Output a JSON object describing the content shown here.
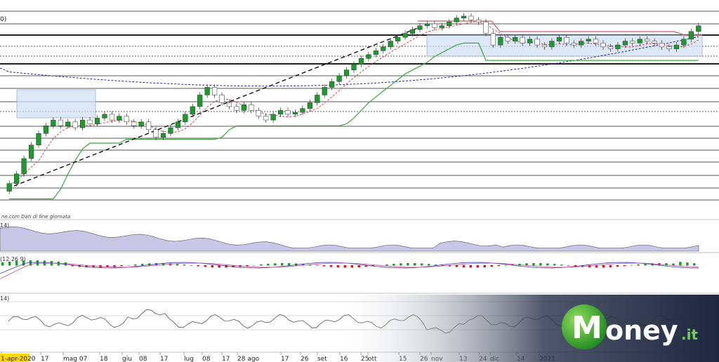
{
  "chart_data": {
    "type": "candlestick",
    "source_note": "ne.com  Dati di fine giornata",
    "x_tick_labels": [
      {
        "label": "1-apr-2020",
        "highlight": true
      },
      {
        "label": "17"
      },
      {
        "label": "mag 07"
      },
      {
        "label": "18"
      },
      {
        "label": "giu"
      },
      {
        "label": "08"
      },
      {
        "label": "17"
      },
      {
        "label": "lug"
      },
      {
        "label": "08"
      },
      {
        "label": "17"
      },
      {
        "label": "28 ago"
      },
      {
        "label": "17"
      },
      {
        "label": "26"
      },
      {
        "label": "set"
      },
      {
        "label": "16"
      },
      {
        "label": "25"
      },
      {
        "label": "ott"
      },
      {
        "label": "15"
      },
      {
        "label": "26"
      },
      {
        "label": "nov"
      },
      {
        "label": "13"
      },
      {
        "label": "24"
      },
      {
        "label": "dic"
      },
      {
        "label": "14"
      },
      {
        "label": "2021"
      }
    ],
    "price_series": [
      {
        "o": 10,
        "c": 14
      },
      {
        "o": 14,
        "c": 19
      },
      {
        "o": 19,
        "c": 27
      },
      {
        "o": 27,
        "c": 34
      },
      {
        "o": 34,
        "c": 40
      },
      {
        "o": 40,
        "c": 44
      },
      {
        "o": 44,
        "c": 47
      },
      {
        "o": 47,
        "c": 44
      },
      {
        "o": 44,
        "c": 46
      },
      {
        "o": 46,
        "c": 43
      },
      {
        "o": 43,
        "c": 47
      },
      {
        "o": 47,
        "c": 45
      },
      {
        "o": 45,
        "c": 48
      },
      {
        "o": 48,
        "c": 50
      },
      {
        "o": 50,
        "c": 47
      },
      {
        "o": 47,
        "c": 49
      },
      {
        "o": 49,
        "c": 46
      },
      {
        "o": 46,
        "c": 44
      },
      {
        "o": 44,
        "c": 46
      },
      {
        "o": 46,
        "c": 42
      },
      {
        "o": 42,
        "c": 38
      },
      {
        "o": 38,
        "c": 40
      },
      {
        "o": 40,
        "c": 43
      },
      {
        "o": 43,
        "c": 46
      },
      {
        "o": 46,
        "c": 50
      },
      {
        "o": 50,
        "c": 54
      },
      {
        "o": 54,
        "c": 60
      },
      {
        "o": 60,
        "c": 64
      },
      {
        "o": 64,
        "c": 60
      },
      {
        "o": 60,
        "c": 56
      },
      {
        "o": 56,
        "c": 54
      },
      {
        "o": 54,
        "c": 52
      },
      {
        "o": 52,
        "c": 55
      },
      {
        "o": 55,
        "c": 52
      },
      {
        "o": 52,
        "c": 49
      },
      {
        "o": 49,
        "c": 47
      },
      {
        "o": 47,
        "c": 50
      },
      {
        "o": 50,
        "c": 52
      },
      {
        "o": 52,
        "c": 50
      },
      {
        "o": 50,
        "c": 51
      },
      {
        "o": 51,
        "c": 53
      },
      {
        "o": 53,
        "c": 56
      },
      {
        "o": 56,
        "c": 60
      },
      {
        "o": 60,
        "c": 64
      },
      {
        "o": 64,
        "c": 67
      },
      {
        "o": 67,
        "c": 70
      },
      {
        "o": 70,
        "c": 73
      },
      {
        "o": 73,
        "c": 76
      },
      {
        "o": 76,
        "c": 79
      },
      {
        "o": 79,
        "c": 81
      },
      {
        "o": 81,
        "c": 83
      },
      {
        "o": 83,
        "c": 85
      },
      {
        "o": 85,
        "c": 88
      },
      {
        "o": 88,
        "c": 90
      },
      {
        "o": 90,
        "c": 92
      },
      {
        "o": 92,
        "c": 94
      },
      {
        "o": 94,
        "c": 96
      },
      {
        "o": 96,
        "c": 97
      },
      {
        "o": 97,
        "c": 95
      },
      {
        "o": 95,
        "c": 96
      },
      {
        "o": 96,
        "c": 98
      },
      {
        "o": 98,
        "c": 100
      },
      {
        "o": 100,
        "c": 101
      },
      {
        "o": 101,
        "c": 99
      },
      {
        "o": 99,
        "c": 98
      },
      {
        "o": 98,
        "c": 92
      },
      {
        "o": 92,
        "c": 86
      },
      {
        "o": 86,
        "c": 90
      },
      {
        "o": 90,
        "c": 88
      },
      {
        "o": 88,
        "c": 90
      },
      {
        "o": 90,
        "c": 87
      },
      {
        "o": 87,
        "c": 89
      },
      {
        "o": 89,
        "c": 86
      },
      {
        "o": 86,
        "c": 85
      },
      {
        "o": 85,
        "c": 88
      },
      {
        "o": 88,
        "c": 90
      },
      {
        "o": 90,
        "c": 87
      },
      {
        "o": 87,
        "c": 86
      },
      {
        "o": 86,
        "c": 88
      },
      {
        "o": 88,
        "c": 89
      },
      {
        "o": 89,
        "c": 87
      },
      {
        "o": 87,
        "c": 85
      },
      {
        "o": 85,
        "c": 84
      },
      {
        "o": 84,
        "c": 86
      },
      {
        "o": 86,
        "c": 88
      },
      {
        "o": 88,
        "c": 87
      },
      {
        "o": 87,
        "c": 89
      },
      {
        "o": 89,
        "c": 88
      },
      {
        "o": 88,
        "c": 87
      },
      {
        "o": 87,
        "c": 85
      },
      {
        "o": 85,
        "c": 84
      },
      {
        "o": 84,
        "c": 86
      },
      {
        "o": 86,
        "c": 89
      },
      {
        "o": 89,
        "c": 93
      },
      {
        "o": 93,
        "c": 96
      }
    ],
    "price_ylim": [
      0,
      105
    ],
    "colors": {
      "up": "#1a9b2c",
      "down": "#c0202a",
      "trend_line": "#111111",
      "ma_short": "#d94a4a",
      "ma_long": "#2a2a9a",
      "trailing_stop": "#3aa83a",
      "resistance": "#c86060",
      "box_fill": "#cfe0f5",
      "volume_fill": "#c8c8e6",
      "histogram": "#1a9b2c",
      "histogram_neg": "#c0202a",
      "panel_line": "#555555"
    },
    "panels": {
      "volume": {
        "label": "14)"
      },
      "macd": {
        "label": "(12 26 9)"
      },
      "oscillator": {
        "label": "14)"
      }
    },
    "chart_label_left": "0)",
    "logo": {
      "letter": "M",
      "text": "oney",
      "suffix": ".it"
    }
  }
}
